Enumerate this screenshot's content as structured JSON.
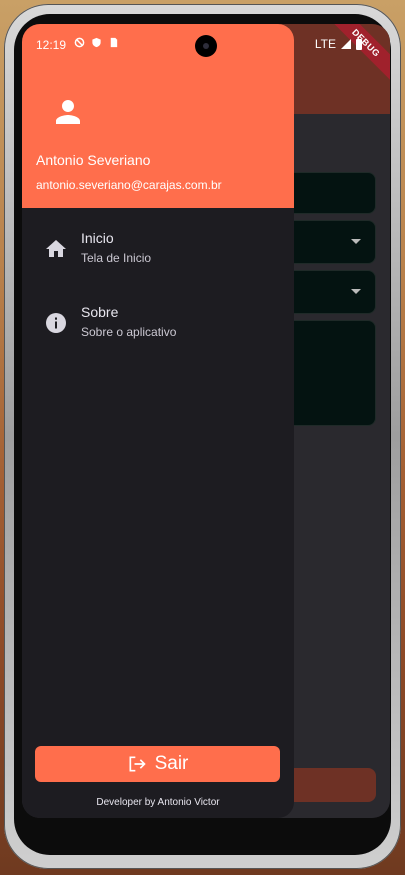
{
  "status_bar": {
    "time": "12:19",
    "network": "LTE"
  },
  "debug_banner": "DEBUG",
  "drawer": {
    "user": {
      "name": "Antonio Severiano",
      "email": "antonio.severiano@carajas.com.br"
    },
    "menu": [
      {
        "title": "Inicio",
        "subtitle": "Tela de Inicio",
        "icon": "home-icon"
      },
      {
        "title": "Sobre",
        "subtitle": "Sobre o aplicativo",
        "icon": "info-icon"
      }
    ],
    "logout_label": "Sair",
    "footer": "Developer by Antonio Victor"
  },
  "colors": {
    "accent": "#ff6e4c",
    "drawer_bg": "#1d1c21",
    "app_bar": "#6e3125",
    "field_bg": "#041311"
  }
}
